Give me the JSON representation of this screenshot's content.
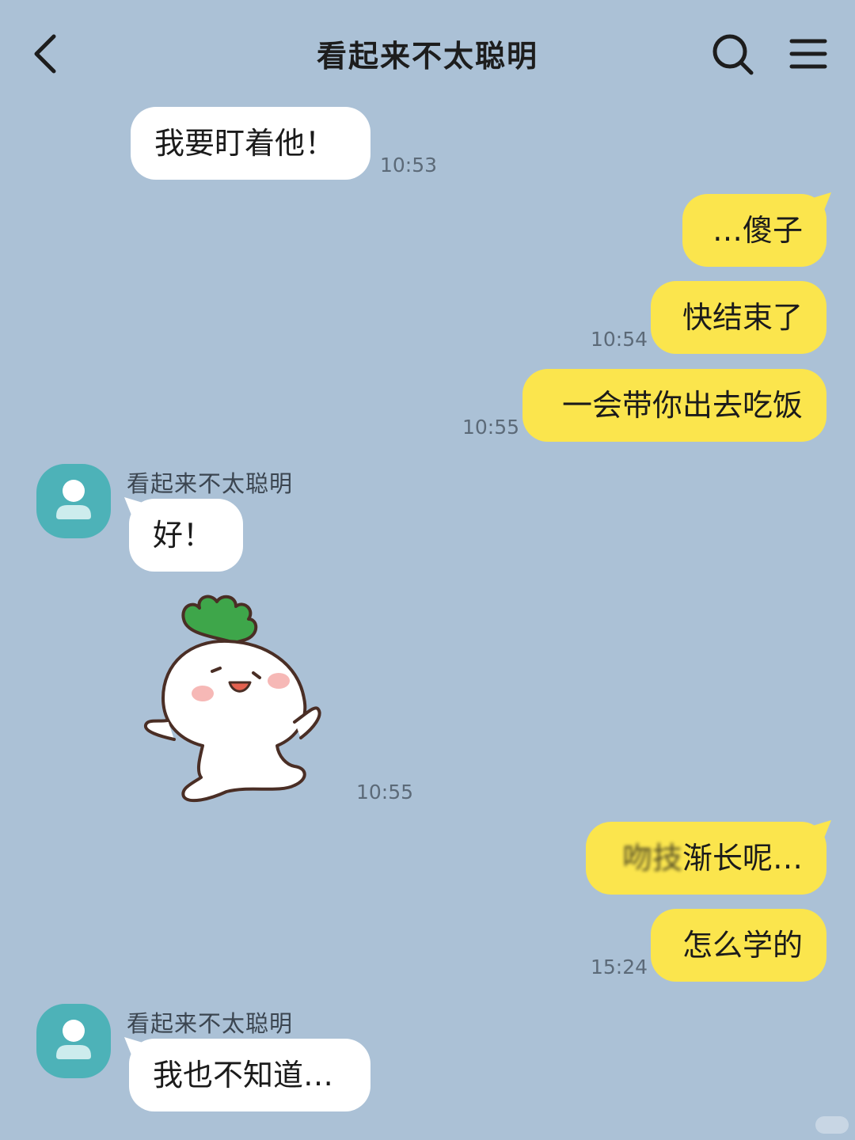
{
  "header": {
    "title": "看起来不太聪明",
    "back_icon": "chevron-left-icon",
    "search_icon": "search-icon",
    "menu_icon": "menu-icon"
  },
  "messages": [
    {
      "direction": "in",
      "text": "我要盯着他！",
      "time": "10:53"
    },
    {
      "direction": "out",
      "text": "…傻子"
    },
    {
      "direction": "out",
      "text": "快结束了",
      "time": "10:54"
    },
    {
      "direction": "out",
      "text": "一会带你出去吃饭",
      "time": "10:55"
    },
    {
      "direction": "in",
      "sender": "看起来不太聪明",
      "text": "好！"
    },
    {
      "direction": "in",
      "type": "sticker",
      "sticker": "radish-sticker",
      "time": "10:55"
    },
    {
      "direction": "out",
      "text_blurred": "吻技",
      "text": "渐长呢…"
    },
    {
      "direction": "out",
      "text": "怎么学的",
      "time": "15:24"
    },
    {
      "direction": "in",
      "sender": "看起来不太聪明",
      "text": "我也不知道…"
    }
  ],
  "colors": {
    "background": "#abc1d6",
    "incoming_bubble": "#ffffff",
    "outgoing_bubble": "#fbe54d",
    "avatar": "#4db2b8"
  }
}
